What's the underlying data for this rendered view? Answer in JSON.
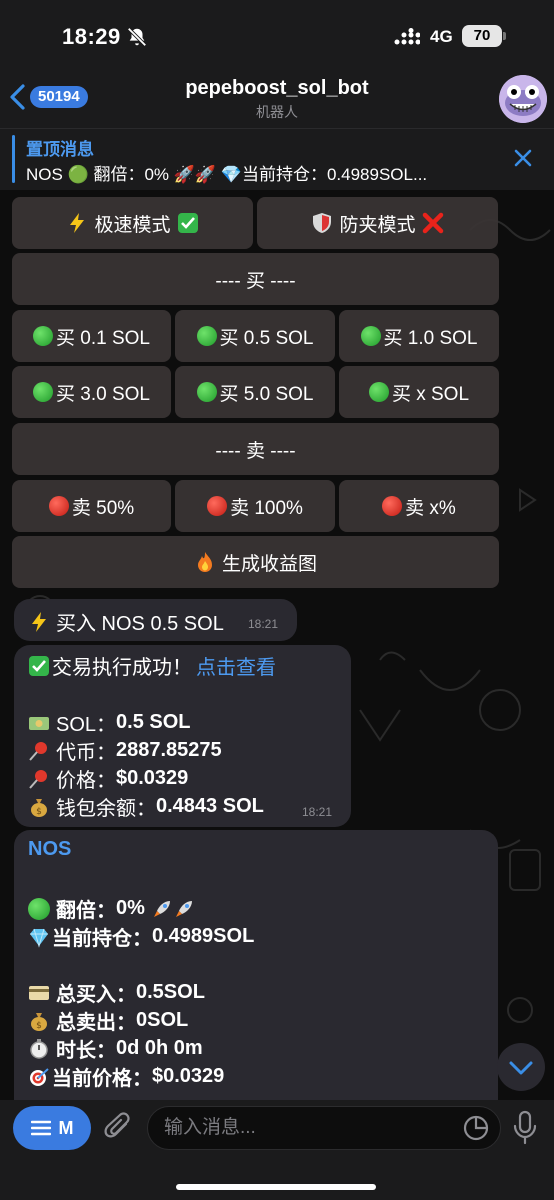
{
  "status": {
    "time": "18:29",
    "network": "4G",
    "battery": "70"
  },
  "header": {
    "back_count": "50194",
    "title": "pepeboost_sol_bot",
    "subtitle": "机器人"
  },
  "pinned": {
    "title": "置顶消息",
    "text": "NOS 🟢 翻倍：0% 🚀🚀 💎当前持仓：0.4989SOL..."
  },
  "keyboard": {
    "mode_fast": "极速模式",
    "mode_antisandwich": "防夹模式",
    "buy_header": "---- 买 ----",
    "buy": [
      "买 0.1 SOL",
      "买 0.5 SOL",
      "买 1.0 SOL",
      "买 3.0 SOL",
      "买 5.0 SOL",
      "买 x SOL"
    ],
    "sell_header": "---- 卖 ----",
    "sell": [
      "卖 50%",
      "卖 100%",
      "卖 x%"
    ],
    "chart": "生成收益图"
  },
  "messages": {
    "m1": {
      "text": "买入 NOS 0.5 SOL",
      "time": "18:21"
    },
    "m2": {
      "title": "交易执行成功！",
      "link": "点击查看",
      "sol_label": "SOL：",
      "sol": "0.5 SOL",
      "token_label": "代币：",
      "token": "2887.85275",
      "price_label": "价格：",
      "price": "$0.0329",
      "wallet_label": "钱包余额：",
      "wallet": "0.4843 SOL",
      "time": "18:21"
    },
    "m3": {
      "name": "NOS",
      "double_label": "翻倍：",
      "double": "0%",
      "holding_label": "当前持仓：",
      "holding": "0.4989SOL",
      "total_buy_label": "总买入：",
      "total_buy": "0.5SOL",
      "total_sell_label": "总卖出：",
      "total_sell": "0SOL",
      "duration_label": "时长：",
      "duration": "0d 0h 0m",
      "current_price_label": "当前价格：",
      "current_price": "$0.0329"
    }
  },
  "composer": {
    "menu_label": "M",
    "placeholder": "输入消息..."
  },
  "colors": {
    "accent": "#3a7be0",
    "link": "#4d9af0",
    "bubble": "#2a2930",
    "button": "#3a3434"
  }
}
